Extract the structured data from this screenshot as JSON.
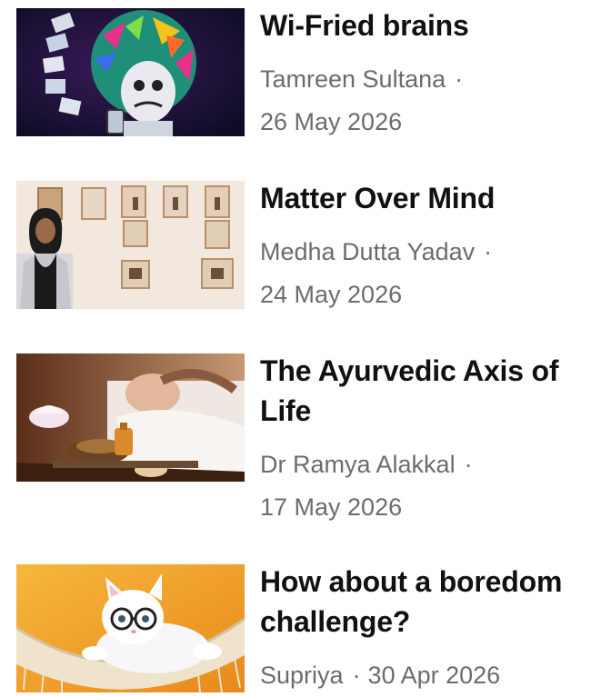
{
  "articles": [
    {
      "title": "Wi-Fried brains",
      "author": "Tamreen Sultana",
      "separator": "·",
      "date": "26 May 2026",
      "thumbnail_icon": "cartoon-phone-overload-image"
    },
    {
      "title": "Matter Over Mind",
      "author": "Medha Dutta Yadav",
      "separator": "·",
      "date": "24 May 2026",
      "thumbnail_icon": "woman-art-exhibit-image"
    },
    {
      "title": "The Ayurvedic Axis of Life",
      "author": "Dr Ramya Alakkal",
      "separator": "·",
      "date": "17 May 2026",
      "thumbnail_icon": "ayurvedic-massage-image"
    },
    {
      "title": "How about a boredom challenge?",
      "author": "Supriya",
      "separator": "·",
      "date": "30 Apr 2026",
      "thumbnail_icon": "cat-in-hammock-image"
    }
  ]
}
